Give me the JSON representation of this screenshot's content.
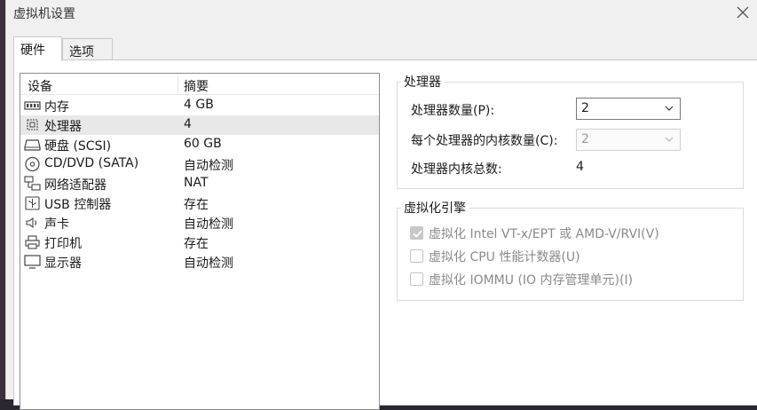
{
  "window": {
    "title": "虚拟机设置"
  },
  "tabs": [
    {
      "label": "硬件",
      "active": true
    },
    {
      "label": "选项",
      "active": false
    }
  ],
  "device_list": {
    "columns": [
      "设备",
      "摘要"
    ],
    "rows": [
      {
        "icon": "memory-icon",
        "name": "内存",
        "summary": "4 GB"
      },
      {
        "icon": "cpu-icon",
        "name": "处理器",
        "summary": "4",
        "selected": true
      },
      {
        "icon": "hard-disk-icon",
        "name": "硬盘 (SCSI)",
        "summary": "60 GB"
      },
      {
        "icon": "cd-dvd-icon",
        "name": "CD/DVD (SATA)",
        "summary": "自动检测"
      },
      {
        "icon": "network-adapter-icon",
        "name": "网络适配器",
        "summary": "NAT"
      },
      {
        "icon": "usb-icon",
        "name": "USB 控制器",
        "summary": "存在"
      },
      {
        "icon": "speaker-icon",
        "name": "声卡",
        "summary": "自动检测"
      },
      {
        "icon": "printer-icon",
        "name": "打印机",
        "summary": "存在"
      },
      {
        "icon": "monitor-icon",
        "name": "显示器",
        "summary": "自动检测"
      }
    ]
  },
  "processor_group": {
    "title": "处理器",
    "cpu_count_label": "处理器数量(P):",
    "cpu_count_value": "2",
    "cores_label": "每个处理器的内核数量(C):",
    "cores_value": "2",
    "total_label": "处理器内核总数:",
    "total_value": "4"
  },
  "virtualization_group": {
    "title": "虚拟化引擎",
    "options": [
      {
        "label": "虚拟化 Intel VT-x/EPT 或 AMD-V/RVI(V)",
        "checked": true
      },
      {
        "label": "虚拟化 CPU 性能计数器(U)",
        "checked": false
      },
      {
        "label": "虚拟化 IOMMU (IO 内存管理单元)(I)",
        "checked": false
      }
    ]
  },
  "colors": {
    "dialog_bg": "#f0f0f0",
    "panel_bg": "#ffffff",
    "selected_row": "#e8e8e8",
    "disabled_text": "#8a8a8a"
  }
}
